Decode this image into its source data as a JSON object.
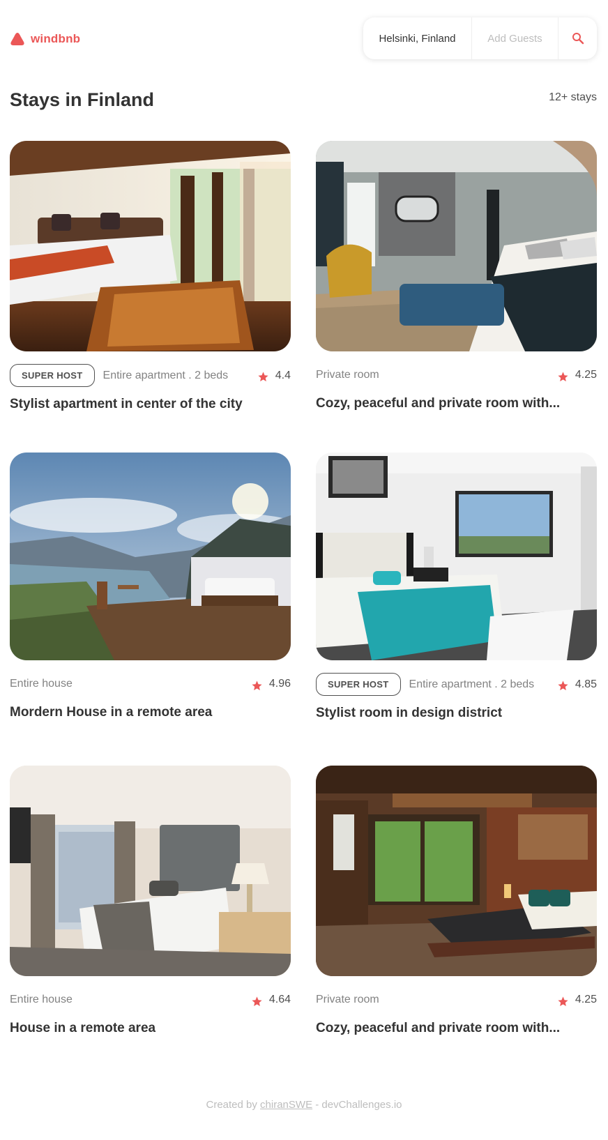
{
  "header": {
    "brand": "windbnb",
    "search": {
      "location": "Helsinki, Finland",
      "guests_placeholder": "Add Guests",
      "search_icon": "search-icon"
    }
  },
  "main": {
    "title": "Stays in Finland",
    "count": "12+ stays"
  },
  "stays": [
    {
      "superhost": "SUPER HOST",
      "type": "Entire apartment . 2 beds",
      "rating": "4.4",
      "title": "Stylist apartment in center of the city"
    },
    {
      "superhost": "",
      "type": "Private room",
      "rating": "4.25",
      "title": "Cozy, peaceful and private room with..."
    },
    {
      "superhost": "",
      "type": "Entire house",
      "rating": "4.96",
      "title": "Mordern House in a remote area"
    },
    {
      "superhost": "SUPER HOST",
      "type": "Entire apartment . 2 beds",
      "rating": "4.85",
      "title": "Stylist room in design district"
    },
    {
      "superhost": "",
      "type": "Entire house",
      "rating": "4.64",
      "title": "House in a remote area"
    },
    {
      "superhost": "",
      "type": "Private room",
      "rating": "4.25",
      "title": "Cozy, peaceful and private room with..."
    }
  ],
  "footer": {
    "prefix": "Created by",
    "author": "chiranSWE",
    "suffix": "- devChallenges.io"
  },
  "colors": {
    "brand": "#EB5757",
    "text": "#333333",
    "muted": "#828282"
  }
}
